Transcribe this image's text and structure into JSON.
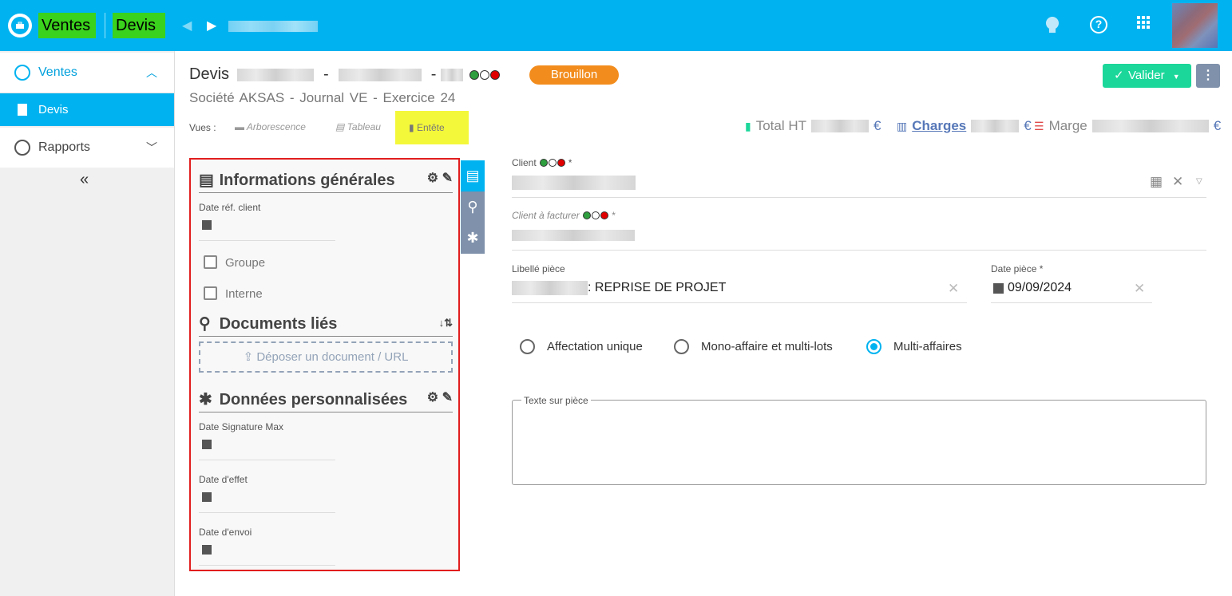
{
  "topbar": {
    "breadcrumb_module": "Ventes",
    "breadcrumb_page": "Devis",
    "icons": [
      "app-logo-icon",
      "bulb-icon",
      "help-icon",
      "apps-grid-icon"
    ]
  },
  "sidebar": {
    "items": [
      {
        "label": "Ventes",
        "icon": "briefcase-icon",
        "expanded": true
      },
      {
        "label": "Devis",
        "icon": "document-icon",
        "active": true
      },
      {
        "label": "Rapports",
        "icon": "chart-icon",
        "expanded": false
      }
    ],
    "collapse_glyph": "«"
  },
  "header": {
    "doc_type": "Devis",
    "sep": "-",
    "status": "Brouillon",
    "subtitle": "Société AKSAS -  Journal VE -  Exercice 24",
    "vues_label": "Vues :",
    "views": [
      "Arborescence",
      "Tableau",
      "Entête"
    ],
    "active_view": "Entête",
    "valider_label": "Valider",
    "kpis": {
      "total_label": "Total HT",
      "charges_label": "Charges",
      "marge_label": "Marge",
      "currency": "€"
    }
  },
  "panel": {
    "info_title": "Informations générales",
    "date_ref_label": "Date réf. client",
    "groupe_label": "Groupe",
    "interne_label": "Interne",
    "docs_title": "Documents liés",
    "upload_label": "Déposer un document / URL",
    "custom_title": "Données personnalisées",
    "date_signature_label": "Date Signature Max",
    "date_effet_label": "Date d'effet",
    "date_envoi_label": "Date d'envoi"
  },
  "form": {
    "client_label": "Client",
    "client_facturer_label": "Client à facturer",
    "required_mark": "*",
    "libelle_label": "Libellé pièce",
    "libelle_value": ": REPRISE DE PROJET",
    "date_piece_label": "Date pièce *",
    "date_piece_value": "09/09/2024",
    "radios": [
      {
        "label": "Affectation unique",
        "checked": false
      },
      {
        "label": "Mono-affaire et multi-lots",
        "checked": false
      },
      {
        "label": "Multi-affaires",
        "checked": true
      }
    ],
    "texte_label": "Texte sur pièce"
  },
  "colors": {
    "brand": "#00b3f0",
    "status": "#f28c1c",
    "valider": "#1cd79a",
    "panel_border": "#e21e1e",
    "highlight": "#f4f83a"
  }
}
